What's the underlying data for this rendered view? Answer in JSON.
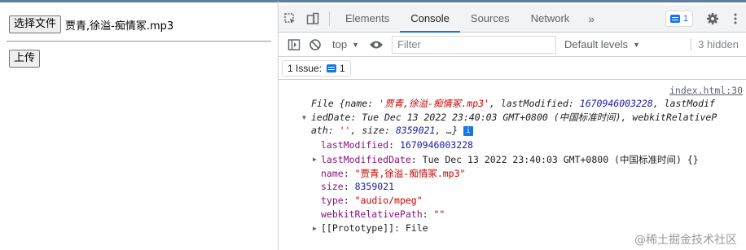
{
  "page": {
    "choose_file_label": "选择文件",
    "selected_file_name": "贾青,徐溢-痴情冢.mp3",
    "upload_label": "上传"
  },
  "devtools": {
    "tabs": [
      "Elements",
      "Console",
      "Sources",
      "Network"
    ],
    "active_tab": "Console",
    "more_tabs": "»",
    "message_count": "1",
    "context": "top",
    "filter_placeholder": "Filter",
    "levels_label": "Default levels",
    "hidden_count": "3 hidden",
    "issues_label": "1 Issue:",
    "issues_count": "1"
  },
  "console": {
    "source_link": "index.html:30",
    "summary_line1_prefix": "File {name: ",
    "summary_name": "'贾青,徐溢-痴情冢.mp3'",
    "summary_line1_mid": ", lastModified: ",
    "summary_lastmodified": "1670946003228",
    "summary_line1_tail": ", lastModif",
    "summary_line2_prefix": "iedDate: Tue Dec 13 2022 23:40:03 GMT+0800 (中国标准时间), webkitRelativeP",
    "summary_line3_prefix": "ath: ",
    "summary_path": "''",
    "summary_line3_mid": ", size: ",
    "summary_size": "8359021",
    "summary_line3_tail": ", …}",
    "info_icon": "i",
    "props": {
      "lastModified_key": "lastModified",
      "lastModified_val": "1670946003228",
      "lastModifiedDate_key": "lastModifiedDate",
      "lastModifiedDate_val": "Tue Dec 13 2022 23:40:03 GMT+0800 (中国标准时间) {}",
      "name_key": "name",
      "name_val": "\"贾青,徐溢-痴情冢.mp3\"",
      "size_key": "size",
      "size_val": "8359021",
      "type_key": "type",
      "type_val": "\"audio/mpeg\"",
      "webkit_key": "webkitRelativePath",
      "webkit_val": "\"\"",
      "proto_key": "[[Prototype]]",
      "proto_val": "File"
    },
    "watermark": "@稀土掘金技术社区"
  },
  "colors": {
    "accent": "#1a73e8",
    "string_red": "#c80000",
    "key_purple": "#881280",
    "number_blue": "#1a1aa6"
  }
}
